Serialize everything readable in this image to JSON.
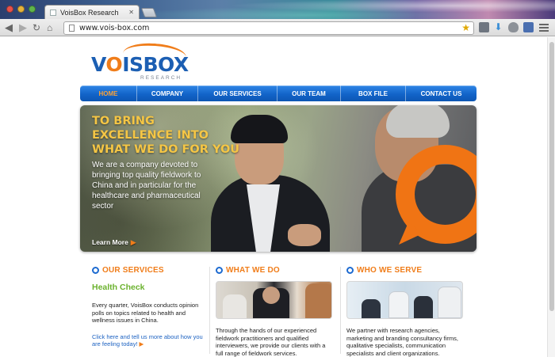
{
  "browser": {
    "tab_title": "VoisBox Research",
    "tab_close": "✕",
    "url": "www.vois-box.com"
  },
  "site": {
    "logo_text_pre": "V",
    "logo_text_o": "O",
    "logo_text_post": "ISBOX",
    "logo_sub": "RESEARCH",
    "accent_blue": "#1264c9",
    "accent_orange": "#f07d1a",
    "nav": [
      {
        "label": "HOME",
        "active": true
      },
      {
        "label": "COMPANY",
        "active": false
      },
      {
        "label": "OUR SERVICES",
        "active": false
      },
      {
        "label": "OUR TEAM",
        "active": false
      },
      {
        "label": "BOX FILE",
        "active": false
      },
      {
        "label": "CONTACT US",
        "active": false
      }
    ],
    "hero": {
      "headline_line1": "TO BRING",
      "headline_line2": "EXCELLENCE INTO",
      "headline_line3": "WHAT WE DO FOR YOU",
      "blurb": "We are a company devoted to bringing top quality fieldwork to China and in particular for the healthcare and pharmaceutical sector",
      "learn_more": "Learn More"
    },
    "columns": {
      "services": {
        "heading": "OUR SERVICES",
        "subheading": "Health Check",
        "body": "Every quarter, VoisBox conducts opinion polls on topics related to health and wellness issues in China.",
        "cta": "Click here and tell us more about how you are feeling today!"
      },
      "what_we_do": {
        "heading": "WHAT WE DO",
        "body": "Through the hands of our experienced fieldwork practitioners and qualified interviewers, we provide our clients with a full range of fieldwork services."
      },
      "who_we_serve": {
        "heading": "WHO WE SERVE",
        "body": "We partner with research agencies, marketing and branding consultancy firms, qualitative specialists, communication specialists and client organizations."
      }
    }
  }
}
